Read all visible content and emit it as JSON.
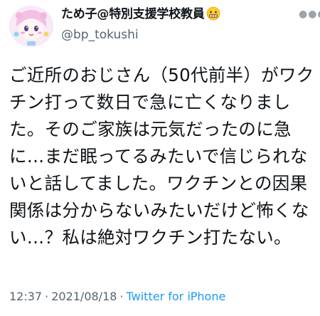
{
  "user": {
    "display_name": "ため子@特別支援学校教員",
    "name_emoji_icon": "grimacing-face-emoji-icon",
    "handle": "@bp_tokushi"
  },
  "tweet": {
    "text": "ご近所のおじさん（50代前半）がワクチン打って数日で急に亡くなりました。そのご家族は元気だったのに急に…まだ眠ってるみたいで信じられないと話してました。ワクチンとの因果関係は分からないみたいだけど怖くない…？私は絶対ワクチン打たない。",
    "time": "12:37",
    "date": "2021/08/18",
    "separator": "·",
    "source": "Twitter for iPhone"
  },
  "colors": {
    "text": "#0f1419",
    "secondary": "#536471",
    "link": "#1d9bf0",
    "avatar_bg": "#f7e8f6"
  },
  "icons": {
    "more": "more-dots-icon",
    "avatar": "pink-character-avatar"
  }
}
